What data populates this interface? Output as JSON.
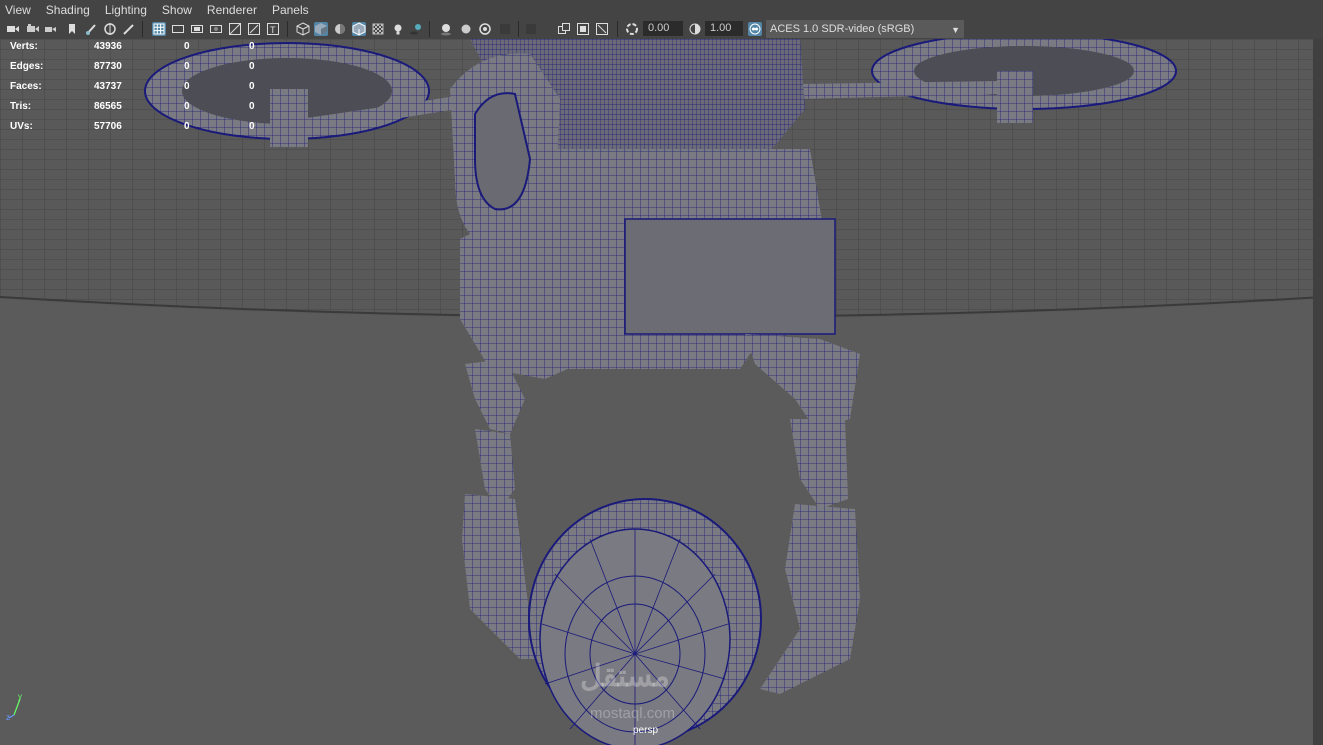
{
  "menubar": {
    "items": [
      "View",
      "Shading",
      "Lighting",
      "Show",
      "Renderer",
      "Panels"
    ]
  },
  "toolbar": {
    "exposure_value": "0.00",
    "gamma_value": "1.00",
    "color_space": "ACES 1.0 SDR-video (sRGB)",
    "icons": [
      "camera-select-icon",
      "camera-attributes-icon",
      "bookmark-icon",
      "image-plane-icon",
      "grid-icon",
      "film-gate-icon",
      "resolution-gate-icon",
      "gate-mask-icon",
      "field-chart-icon",
      "safe-action-icon",
      "safe-title-icon",
      "wireframe-icon",
      "smooth-shade-icon",
      "default-material-icon",
      "wireframe-on-shaded-icon",
      "xray-icon",
      "use-all-lights-icon",
      "shadows-icon",
      "screen-space-ao-icon",
      "motion-blur-icon",
      "isolate-select-icon",
      "multisample-aa-icon",
      "exposure-icon",
      "gamma-icon",
      "color-management-icon"
    ],
    "accent": "#5285a6"
  },
  "hud": {
    "rows": [
      {
        "label": "Verts:",
        "value": "43936",
        "sel": "0",
        "comp": "0"
      },
      {
        "label": "Edges:",
        "value": "87730",
        "sel": "0",
        "comp": "0"
      },
      {
        "label": "Faces:",
        "value": "43737",
        "sel": "0",
        "comp": "0"
      },
      {
        "label": "Tris:",
        "value": "86565",
        "sel": "0",
        "comp": "0"
      },
      {
        "label": "UVs:",
        "value": "57706",
        "sel": "0",
        "comp": "0"
      }
    ]
  },
  "viewport": {
    "camera": "persp",
    "wire_color": "#1a1a7a",
    "mesh_color": "#7a7a82",
    "background": "#5b5b5b"
  },
  "axis": {
    "y": "y",
    "z": "z"
  },
  "watermark": {
    "line1": "مستقل",
    "line2": "mostaql.com"
  }
}
